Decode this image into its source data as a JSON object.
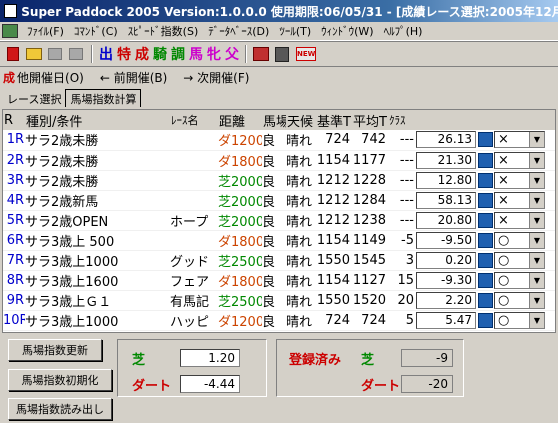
{
  "window": {
    "title": "Super Paddock 2005 Version:1.0.0.0 使用期限:06/05/31 - [成績レース選択:2005年12月25日"
  },
  "menu": {
    "items": [
      "ﾌｧｲﾙ(F)",
      "ｺﾏﾝﾄﾞ(C)",
      "ｽﾋﾟｰﾄﾞ指数(S)",
      "ﾃﾞｰﾀﾍﾞｰｽ(D)",
      "ﾂｰﾙ(T)",
      "ｳｨﾝﾄﾞｳ(W)",
      "ﾍﾙﾌﾟ(H)"
    ]
  },
  "toolbar": {
    "chars": [
      {
        "text": "出",
        "color": "#0000cc"
      },
      {
        "text": "特",
        "color": "#cc0000"
      },
      {
        "text": "成",
        "color": "#cc0000"
      },
      {
        "text": "騎",
        "color": "#008800"
      },
      {
        "text": "調",
        "color": "#008800"
      },
      {
        "text": "馬",
        "color": "#cc00cc"
      },
      {
        "text": "牝",
        "color": "#cc00cc"
      },
      {
        "text": "父",
        "color": "#cc00cc"
      }
    ],
    "news_label": "NEW"
  },
  "nav": {
    "other_day": "他開催日(O)",
    "prev": "← 前開催(B)",
    "next": "→ 次開催(F)",
    "other_mark": "成"
  },
  "tabs": {
    "race_select": "レース選択",
    "track_index": "馬場指数計算"
  },
  "grid": {
    "headers": {
      "r": "R",
      "type": "種別/条件",
      "race": "ﾚｰｽ名",
      "distance": "距離",
      "track": "馬場",
      "weather": "天候",
      "base_t": "基準T",
      "avg_t": "平均T",
      "cls": "ｸﾗｽ"
    },
    "rows": [
      {
        "r": "1R",
        "type": "サラ2歳未勝",
        "race": "",
        "surface": "dirt",
        "dist": "ダ1200",
        "track": "良",
        "weather": "晴れ",
        "base": "724",
        "avg": "742",
        "cls": "---",
        "index": "26.13",
        "mark": "×"
      },
      {
        "r": "2R",
        "type": "サラ2歳未勝",
        "race": "",
        "surface": "dirt",
        "dist": "ダ1800",
        "track": "良",
        "weather": "晴れ",
        "base": "1154",
        "avg": "1177",
        "cls": "---",
        "index": "21.30",
        "mark": "×"
      },
      {
        "r": "3R",
        "type": "サラ2歳未勝",
        "race": "",
        "surface": "turf",
        "dist": "芝2000",
        "track": "良",
        "weather": "晴れ",
        "base": "1212",
        "avg": "1228",
        "cls": "---",
        "index": "12.80",
        "mark": "×"
      },
      {
        "r": "4R",
        "type": "サラ2歳新馬",
        "race": "",
        "surface": "turf",
        "dist": "芝2000",
        "track": "良",
        "weather": "晴れ",
        "base": "1212",
        "avg": "1284",
        "cls": "---",
        "index": "58.13",
        "mark": "×"
      },
      {
        "r": "5R",
        "type": "サラ2歳OPEN",
        "race": "ホープ",
        "surface": "turf",
        "dist": "芝2000",
        "track": "良",
        "weather": "晴れ",
        "base": "1212",
        "avg": "1238",
        "cls": "---",
        "index": "20.80",
        "mark": "×"
      },
      {
        "r": "6R",
        "type": "サラ3歳上 500",
        "race": "",
        "surface": "dirt",
        "dist": "ダ1800",
        "track": "良",
        "weather": "晴れ",
        "base": "1154",
        "avg": "1149",
        "cls": "-5",
        "index": "-9.50",
        "mark": "○"
      },
      {
        "r": "7R",
        "type": "サラ3歳上1000",
        "race": "グッド",
        "surface": "turf",
        "dist": "芝2500",
        "track": "良",
        "weather": "晴れ",
        "base": "1550",
        "avg": "1545",
        "cls": "3",
        "index": "0.20",
        "mark": "○"
      },
      {
        "r": "8R",
        "type": "サラ3歳上1600",
        "race": "フェア",
        "surface": "dirt",
        "dist": "ダ1800",
        "track": "良",
        "weather": "晴れ",
        "base": "1154",
        "avg": "1127",
        "cls": "15",
        "index": "-9.30",
        "mark": "○"
      },
      {
        "r": "9R",
        "type": "サラ3歳上Ｇ１",
        "race": "有馬記",
        "surface": "turf",
        "dist": "芝2500",
        "track": "良",
        "weather": "晴れ",
        "base": "1550",
        "avg": "1520",
        "cls": "20",
        "index": "2.20",
        "mark": "○"
      },
      {
        "r": "10R",
        "type": "サラ3歳上1000",
        "race": "ハッピ",
        "surface": "dirt",
        "dist": "ダ1200",
        "track": "良",
        "weather": "晴れ",
        "base": "724",
        "avg": "724",
        "cls": "5",
        "index": "5.47",
        "mark": "○"
      }
    ]
  },
  "bottom": {
    "btn_update": "馬場指数更新",
    "btn_init": "馬場指数初期化",
    "btn_load": "馬場指数読み出し",
    "turf_label": "芝",
    "turf_value": "1.20",
    "dirt_label": "ダート",
    "dirt_value": "-4.44",
    "registered_label": "登録済み",
    "reg_turf_label": "芝",
    "reg_turf_value": "-9",
    "reg_dirt_label": "ダート",
    "reg_dirt_value": "-20"
  },
  "colors": {
    "turf": "#008800",
    "dirt": "#cc4400",
    "race_no": "#0000cc",
    "registered": "#cc0000"
  }
}
